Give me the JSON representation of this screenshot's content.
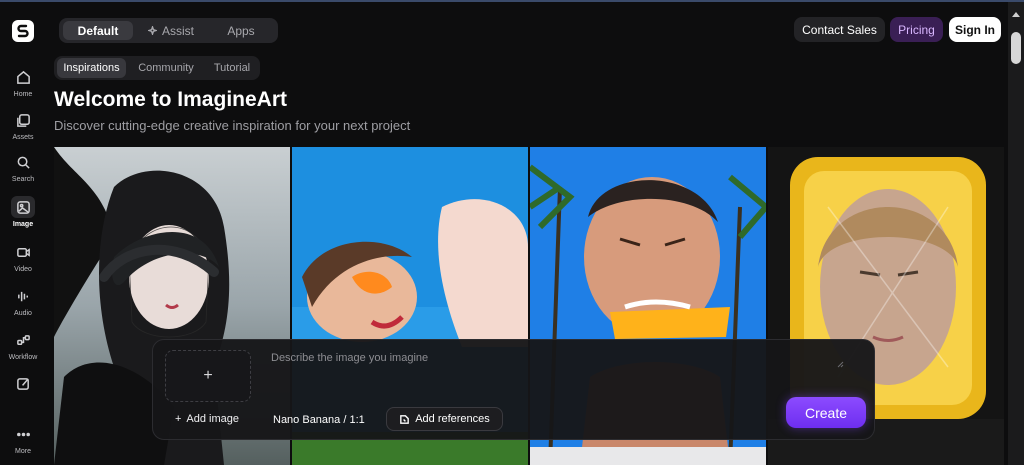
{
  "sidebar": {
    "items": [
      {
        "label": "Home",
        "icon": "home-icon"
      },
      {
        "label": "Assets",
        "icon": "assets-icon"
      },
      {
        "label": "Search",
        "icon": "search-icon"
      },
      {
        "label": "Image",
        "icon": "image-icon",
        "active": true
      },
      {
        "label": "Video",
        "icon": "video-icon"
      },
      {
        "label": "Audio",
        "icon": "audio-icon"
      },
      {
        "label": "Workflow",
        "icon": "workflow-icon"
      },
      {
        "label": "",
        "icon": "edit-icon"
      },
      {
        "label": "More",
        "icon": "more-icon"
      }
    ]
  },
  "header": {
    "modes": [
      "Default",
      "Assist",
      "Apps"
    ],
    "active_mode": "Default",
    "contact_label": "Contact Sales",
    "pricing_label": "Pricing",
    "signin_label": "Sign In"
  },
  "subtabs": {
    "items": [
      "Inspirations",
      "Community",
      "Tutorial"
    ],
    "active": "Inspirations"
  },
  "main": {
    "title": "Welcome to ImagineArt",
    "subtitle": "Discover cutting-edge creative inspiration for your next project"
  },
  "prompt": {
    "placeholder": "Describe the image you imagine",
    "add_image_label": "Add image",
    "model_label": "Nano Banana / 1:1",
    "references_label": "Add references",
    "create_label": "Create"
  },
  "colors": {
    "background": "#0d0d0e",
    "accent": "#7c3cff",
    "pricing_bg": "#3a1f55"
  }
}
